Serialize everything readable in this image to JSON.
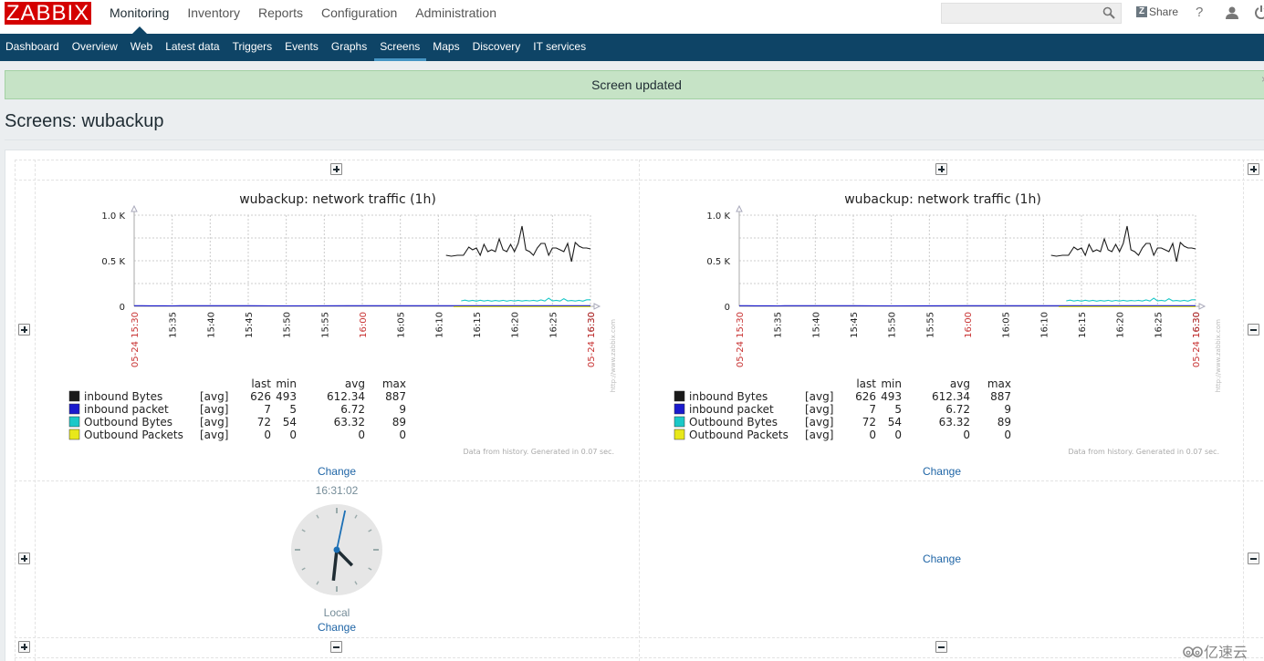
{
  "header": {
    "logo": "ZABBIX",
    "main_nav": [
      "Monitoring",
      "Inventory",
      "Reports",
      "Configuration",
      "Administration"
    ],
    "active_main": "Monitoring",
    "search": {
      "value": "",
      "placeholder": ""
    },
    "share_label": "Share",
    "help_label": "?"
  },
  "sub_nav": {
    "items": [
      "Dashboard",
      "Overview",
      "Web",
      "Latest data",
      "Triggers",
      "Events",
      "Graphs",
      "Screens",
      "Maps",
      "Discovery",
      "IT services"
    ],
    "active": "Screens"
  },
  "message": {
    "text": "Screen updated",
    "close": "×"
  },
  "page_title": "Screens: wubackup",
  "screen": {
    "change_label": "Change",
    "graphs": [
      {
        "cell": "top-left"
      },
      {
        "cell": "top-right"
      }
    ],
    "clock": {
      "time": "16:31:02",
      "label": "Local",
      "hours": 16,
      "minutes": 31,
      "seconds": 2
    },
    "empty_cell_label": "Change"
  },
  "chart_data": [
    {
      "type": "line",
      "title": "wubackup: network traffic (1h)",
      "ylim": [
        0,
        1000
      ],
      "y_ticks": [
        "0",
        "0.5 K",
        "1.0 K"
      ],
      "x_tick_labels": [
        "15:35",
        "15:40",
        "15:45",
        "15:50",
        "15:55",
        "16:00",
        "16:05",
        "16:10",
        "16:15",
        "16:20",
        "16:25",
        "16:30"
      ],
      "x_tick_minutes": [
        5,
        10,
        15,
        20,
        25,
        30,
        35,
        40,
        45,
        50,
        55,
        60
      ],
      "x_tick_red": [
        "16:00"
      ],
      "x_start_label": "05-24 15:30",
      "x_end_label": "05-24 16:30",
      "x_range_minutes": [
        0,
        60
      ],
      "grid": true,
      "watermark": "http://www.zabbix.com",
      "footer": "Data from history. Generated in 0.07 sec.",
      "legend_headers": [
        "last",
        "min",
        "avg",
        "max"
      ],
      "series": [
        {
          "name": "inbound Bytes",
          "func": "[avg]",
          "color": "#1a1a1a",
          "last": "626",
          "min": "493",
          "avg": "612.34",
          "max": "887",
          "x": [
            41.0,
            41.7,
            42.5,
            43.3,
            44.0,
            44.5,
            45.0,
            45.5,
            46.0,
            46.5,
            47.0,
            47.5,
            48.0,
            48.5,
            49.0,
            49.5,
            50.0,
            50.5,
            51.0,
            51.5,
            52.0,
            52.5,
            53.0,
            53.5,
            54.0,
            54.5,
            55.0,
            55.5,
            56.0,
            56.5,
            57.0,
            57.5,
            58.0,
            58.5,
            59.0,
            59.5,
            60.0
          ],
          "values": [
            560,
            550,
            560,
            560,
            650,
            620,
            640,
            560,
            680,
            600,
            620,
            600,
            740,
            620,
            600,
            680,
            600,
            690,
            880,
            620,
            600,
            560,
            640,
            690,
            690,
            560,
            640,
            640,
            620,
            600,
            690,
            490,
            700,
            660,
            640,
            640,
            630
          ]
        },
        {
          "name": "inbound packet",
          "func": "[avg]",
          "color": "#1a1acd",
          "last": "7",
          "min": "5",
          "avg": "6.72",
          "max": "9",
          "x": [
            0,
            1,
            2,
            3,
            4,
            5,
            6,
            7,
            8,
            9,
            10,
            15,
            20,
            30,
            40,
            50,
            60
          ],
          "values": [
            7,
            7,
            6,
            6,
            6,
            5,
            7,
            7,
            7,
            7,
            7,
            7,
            5,
            7,
            7,
            7,
            7
          ]
        },
        {
          "name": "Outbound Bytes",
          "func": "[avg]",
          "color": "#1ac8c8",
          "last": "72",
          "min": "54",
          "avg": "63.32",
          "max": "89",
          "x": [
            43.0,
            43.5,
            44.0,
            44.5,
            45.0,
            45.5,
            46.0,
            46.5,
            47.0,
            47.5,
            48.0,
            48.5,
            49.0,
            49.5,
            50.0,
            50.5,
            51.0,
            51.5,
            52.0,
            52.5,
            53.0,
            53.5,
            54.0,
            54.5,
            55.0,
            55.5,
            56.0,
            56.5,
            57.0,
            57.5,
            58.0,
            58.5,
            59.0,
            59.5,
            60.0
          ],
          "values": [
            60,
            68,
            58,
            66,
            57,
            67,
            58,
            66,
            57,
            64,
            58,
            66,
            57,
            65,
            58,
            66,
            58,
            64,
            60,
            66,
            58,
            70,
            58,
            89,
            60,
            66,
            58,
            84,
            60,
            64,
            58,
            66,
            57,
            72,
            72
          ]
        },
        {
          "name": "Outbound Packets",
          "func": "[avg]",
          "color": "#e8e81a",
          "last": "0",
          "min": "0",
          "avg": "0",
          "max": "0",
          "x": [
            42,
            60
          ],
          "values": [
            0,
            0
          ]
        }
      ]
    }
  ],
  "watermark_brand": "亿速云"
}
